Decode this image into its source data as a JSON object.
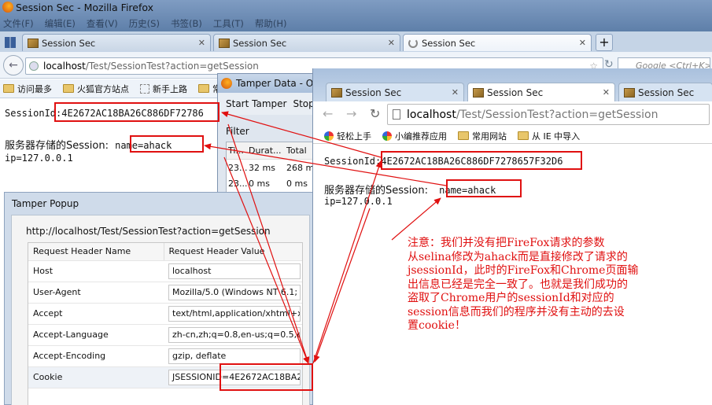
{
  "firefox": {
    "title": "Session Sec - Mozilla Firefox",
    "menu": [
      "文件(F)",
      "编辑(E)",
      "查看(V)",
      "历史(S)",
      "书签(B)",
      "工具(T)",
      "帮助(H)"
    ],
    "tabs": [
      "Session Sec",
      "Session Sec",
      "Session Sec"
    ],
    "new_tab": "+",
    "url_host": "localhost",
    "url_path": "/Test/SessionTest?action=getSession",
    "search_placeholder": "Google <Ctrl+K>",
    "bookmarks": [
      "访问最多",
      "火狐官方站点",
      "新手上路",
      "常"
    ],
    "page": {
      "session_label": "SessionId:",
      "session_value": "4E2672AC18BA26C886DF72786",
      "store_label": "服务器存储的Session:",
      "store_value": "name=ahack",
      "ip_line": "ip=127.0.0.1"
    }
  },
  "tamper_data": {
    "title": "Tamper Data - O",
    "start_button": "Start Tamper",
    "stop_button": "Stop",
    "filter_label": "Filter",
    "columns": [
      "Ti...",
      "Durat...",
      "Total"
    ],
    "rows": [
      [
        "23...",
        "32 ms",
        "268 m"
      ],
      [
        "23...",
        "0 ms",
        "0 ms"
      ]
    ]
  },
  "tamper_popup": {
    "title": "Tamper Popup",
    "url": "http://localhost/Test/SessionTest?action=getSession",
    "col_name": "Request Header Name",
    "col_value": "Request Header Value",
    "headers": [
      {
        "name": "Host",
        "value": "localhost"
      },
      {
        "name": "User-Agent",
        "value": "Mozilla/5.0 (Windows NT 6.1; r"
      },
      {
        "name": "Accept",
        "value": "text/html,application/xhtml+x"
      },
      {
        "name": "Accept-Language",
        "value": "zh-cn,zh;q=0.8,en-us;q=0.5,en"
      },
      {
        "name": "Accept-Encoding",
        "value": "gzip, deflate"
      },
      {
        "name": "Cookie",
        "value": "JSESSIONID=4E2672AC18BA2("
      }
    ]
  },
  "chrome": {
    "tabs": [
      "Session Sec",
      "Session Sec",
      "Session Sec"
    ],
    "url_host": "localhost",
    "url_path": "/Test/SessionTest?action=getSession",
    "bookmarks": [
      "轻松上手",
      "小编推荐应用",
      "常用网站",
      "从 IE 中导入"
    ],
    "page": {
      "session_label": "SessionId:",
      "session_value": "4E2672AC18BA26C886DF7278657F32D6",
      "store_label": "服务器存储的Session:",
      "store_value": "name=ahack",
      "ip_line": "ip=127.0.0.1"
    }
  },
  "annotation": {
    "lines": [
      "注意：我们并没有把FireFox请求的参数",
      "从selina修改为ahack而是直接修改了请求的",
      "jsessionId，此时的FireFox和Chrome页面输",
      "出信息已经是完全一致了。也就是我们成功的",
      "盗取了Chrome用户的sessionId和对应的",
      "session信息而我们的程序并没有主动的去设",
      "置cookie！"
    ]
  },
  "colors": {
    "highlight": "#e01010",
    "annotation_text": "#e01010",
    "titlebar": "#6e8fb8"
  }
}
